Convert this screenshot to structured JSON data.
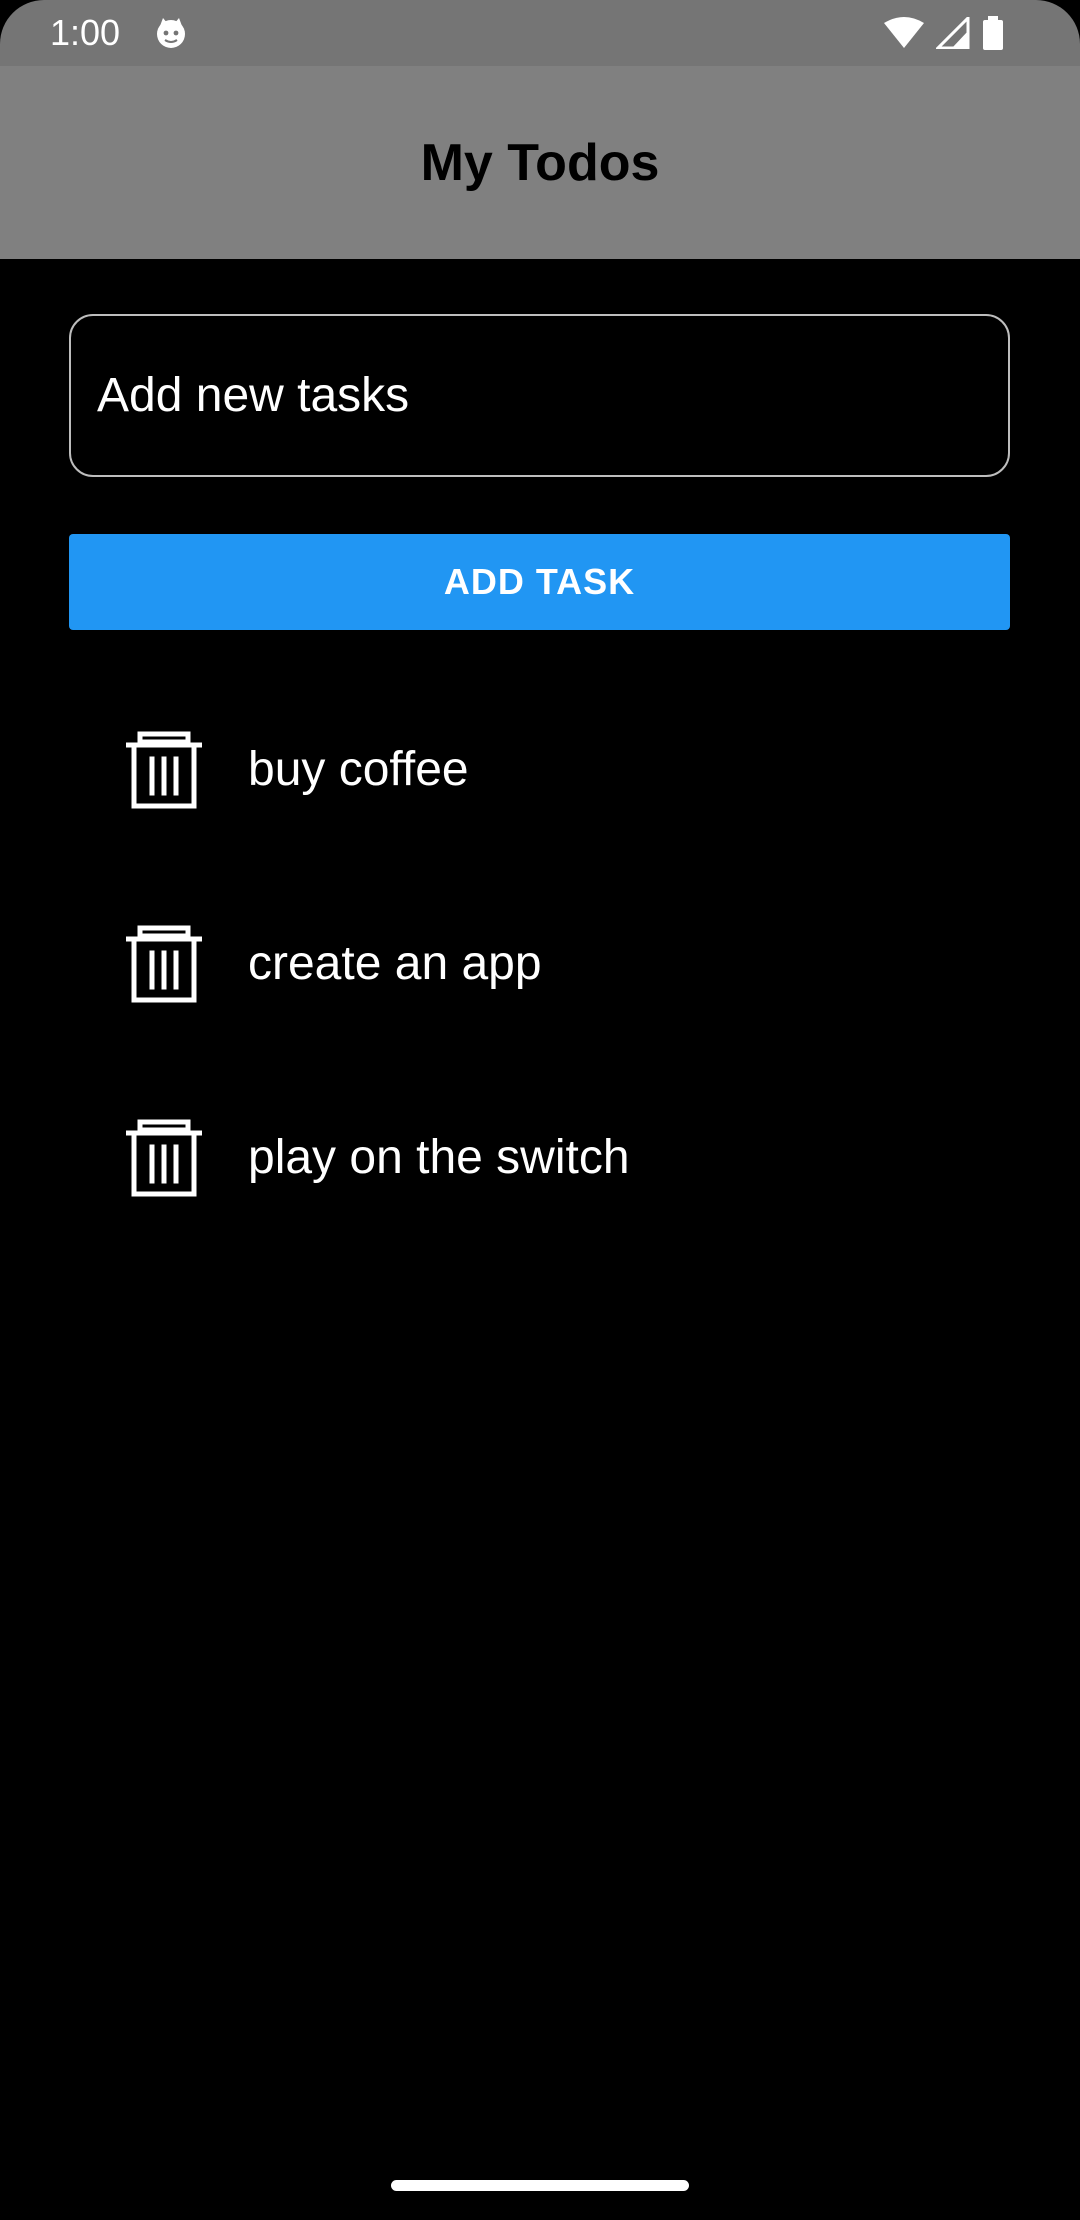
{
  "status_bar": {
    "time": "1:00",
    "app_icon": "notification-cat-icon",
    "icons": [
      "wifi-icon",
      "signal-icon",
      "battery-icon"
    ]
  },
  "app_bar": {
    "title": "My Todos",
    "background": "#808080"
  },
  "input": {
    "placeholder": "Add new tasks",
    "value": ""
  },
  "add_button": {
    "label": "ADD TASK",
    "color": "#2196f3"
  },
  "tasks": [
    {
      "text": "buy coffee",
      "icon": "trash-icon"
    },
    {
      "text": "create an app",
      "icon": "trash-icon"
    },
    {
      "text": "play on the switch",
      "icon": "trash-icon"
    }
  ]
}
